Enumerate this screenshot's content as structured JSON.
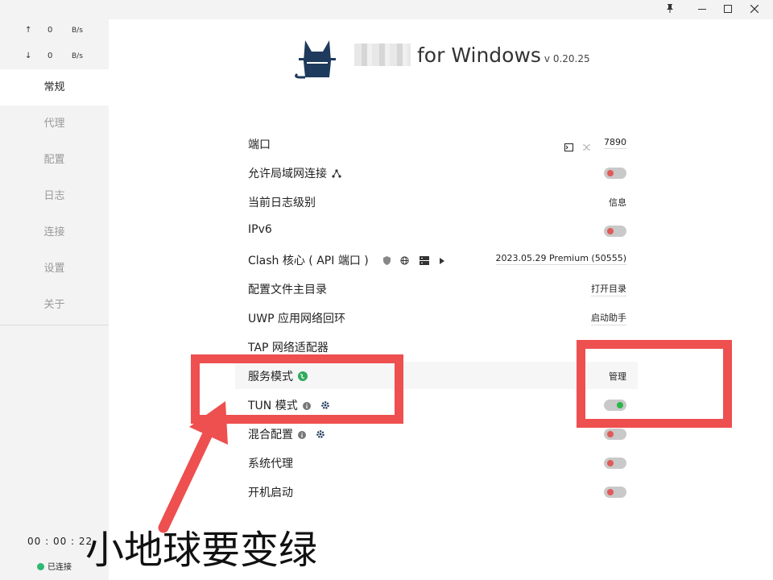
{
  "window": {
    "controls": [
      "pin-icon",
      "minimize-icon",
      "maximize-icon",
      "close-icon"
    ]
  },
  "sidebar": {
    "upload": {
      "arrow": "↑",
      "value": "0",
      "unit": "B/s"
    },
    "download": {
      "arrow": "↓",
      "value": "0",
      "unit": "B/s"
    },
    "items": [
      {
        "label": "常规",
        "active": true
      },
      {
        "label": "代理"
      },
      {
        "label": "配置"
      },
      {
        "label": "日志"
      },
      {
        "label": "连接"
      },
      {
        "label": "设置"
      },
      {
        "label": "关于"
      }
    ],
    "timer": "00 : 00 : 22",
    "status": "已连接",
    "status_color": "#2eb872"
  },
  "header": {
    "title": "for Windows",
    "version": "v 0.20.25"
  },
  "settings": {
    "port": {
      "label": "端口",
      "value": "7890"
    },
    "lan": {
      "label": "允许局域网连接"
    },
    "log_level": {
      "label": "当前日志级别",
      "value": "信息"
    },
    "ipv6": {
      "label": "IPv6"
    },
    "core": {
      "label": "Clash 核心 ( API 端口 )",
      "value": "2023.05.29 Premium (50555)"
    },
    "config_dir": {
      "label": "配置文件主目录",
      "value": "打开目录"
    },
    "uwp": {
      "label": "UWP 应用网络回环",
      "value": "启动助手"
    },
    "tap": {
      "label": "TAP 网络适配器"
    },
    "service": {
      "label": "服务模式",
      "value": "管理"
    },
    "tun": {
      "label": "TUN 模式"
    },
    "mixin": {
      "label": "混合配置"
    },
    "sys_proxy": {
      "label": "系统代理"
    },
    "autostart": {
      "label": "开机启动"
    }
  },
  "colors": {
    "toggle_off_knob": "#e05a5a",
    "toggle_on_knob": "#2bb84a",
    "annotation_red": "#ee4f4f"
  },
  "annotation": {
    "text": "小地球要变绿"
  }
}
